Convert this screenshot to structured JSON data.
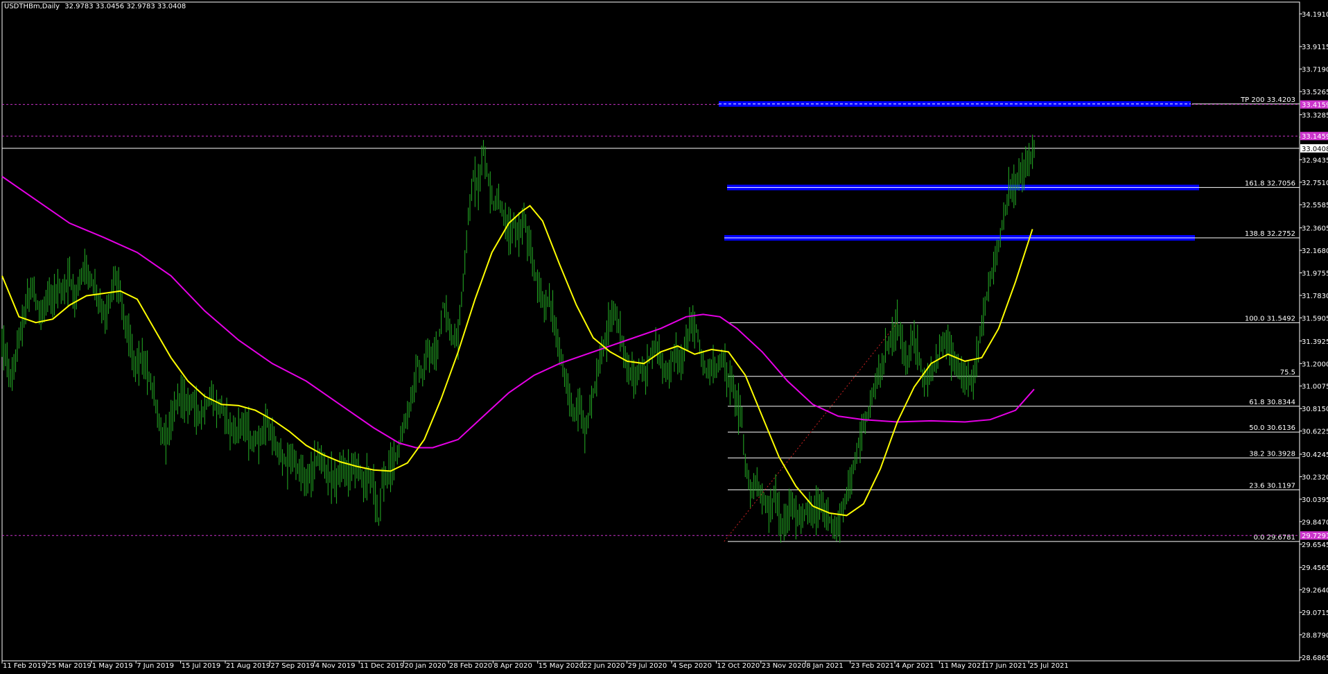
{
  "header": {
    "symbol": "USDTHBm,Daily",
    "ohlc": "32.9783 33.0456 32.9783 33.0408"
  },
  "colors": {
    "background": "#000000",
    "candles": "#22a322",
    "ma_fast": "#ffff00",
    "ma_slow": "#e600e6",
    "fibo_line": "#ffffff",
    "dash_level": "#cc33cc",
    "blue_zone": "#0000ff",
    "trend": "#cc2222"
  },
  "chart_data": {
    "type": "line",
    "title": "",
    "xlabel": "",
    "ylabel": "",
    "ylim": [
      28.6865,
      34.191
    ],
    "y_ticks": [
      "34.1910",
      "33.9115",
      "33.7190",
      "33.5265",
      "33.3285",
      "33.1360",
      "32.9435",
      "32.7510",
      "32.5585",
      "32.3605",
      "32.1680",
      "31.9755",
      "31.7830",
      "31.5905",
      "31.3925",
      "31.2000",
      "31.0075",
      "30.8150",
      "30.6225",
      "30.4245",
      "30.2320",
      "30.0395",
      "29.8470",
      "29.6545",
      "29.4565",
      "29.2640",
      "29.0715",
      "28.8790",
      "28.6865"
    ],
    "x_ticks": [
      "11 Feb 2019",
      "25 Mar 2019",
      "1 May 2019",
      "7 Jun 2019",
      "15 Jul 2019",
      "21 Aug 2019",
      "27 Sep 2019",
      "4 Nov 2019",
      "11 Dec 2019",
      "20 Jan 2020",
      "28 Feb 2020",
      "8 Apr 2020",
      "15 May 2020",
      "22 Jun 2020",
      "29 Jul 2020",
      "4 Sep 2020",
      "12 Oct 2020",
      "23 Nov 2020",
      "8 Jan 2021",
      "23 Feb 2021",
      "4 Apr 2021",
      "11 May 2021",
      "17 Jun 2021",
      "25 Jul 2021"
    ],
    "price_series": [
      [
        0,
        31.4
      ],
      [
        6,
        31.2
      ],
      [
        12,
        31.05
      ],
      [
        18,
        31.35
      ],
      [
        24,
        31.55
      ],
      [
        30,
        31.75
      ],
      [
        36,
        31.85
      ],
      [
        42,
        31.7
      ],
      [
        48,
        31.6
      ],
      [
        54,
        31.8
      ],
      [
        60,
        31.7
      ],
      [
        66,
        31.85
      ],
      [
        72,
        31.8
      ],
      [
        80,
        31.95
      ],
      [
        86,
        31.75
      ],
      [
        92,
        31.9
      ],
      [
        98,
        32.05
      ],
      [
        104,
        31.95
      ],
      [
        110,
        31.85
      ],
      [
        116,
        31.7
      ],
      [
        122,
        31.6
      ],
      [
        128,
        31.75
      ],
      [
        134,
        31.95
      ],
      [
        140,
        31.8
      ],
      [
        146,
        31.55
      ],
      [
        152,
        31.35
      ],
      [
        158,
        31.2
      ],
      [
        164,
        31.25
      ],
      [
        170,
        31.15
      ],
      [
        176,
        31.05
      ],
      [
        182,
        30.85
      ],
      [
        188,
        30.6
      ],
      [
        194,
        30.55
      ],
      [
        200,
        30.7
      ],
      [
        206,
        30.85
      ],
      [
        212,
        30.95
      ],
      [
        218,
        30.85
      ],
      [
        224,
        30.9
      ],
      [
        230,
        30.8
      ],
      [
        236,
        30.75
      ],
      [
        242,
        30.85
      ],
      [
        248,
        30.9
      ],
      [
        254,
        30.8
      ],
      [
        260,
        30.85
      ],
      [
        266,
        30.7
      ],
      [
        272,
        30.65
      ],
      [
        278,
        30.6
      ],
      [
        284,
        30.7
      ],
      [
        290,
        30.65
      ],
      [
        296,
        30.5
      ],
      [
        302,
        30.55
      ],
      [
        308,
        30.6
      ],
      [
        314,
        30.7
      ],
      [
        320,
        30.55
      ],
      [
        326,
        30.45
      ],
      [
        332,
        30.4
      ],
      [
        338,
        30.35
      ],
      [
        344,
        30.4
      ],
      [
        350,
        30.3
      ],
      [
        356,
        30.25
      ],
      [
        362,
        30.2
      ],
      [
        368,
        30.3
      ],
      [
        374,
        30.4
      ],
      [
        380,
        30.35
      ],
      [
        386,
        30.25
      ],
      [
        392,
        30.2
      ],
      [
        398,
        30.25
      ],
      [
        404,
        30.3
      ],
      [
        410,
        30.25
      ],
      [
        416,
        30.35
      ],
      [
        422,
        30.3
      ],
      [
        428,
        30.2
      ],
      [
        434,
        30.25
      ],
      [
        440,
        30.15
      ],
      [
        446,
        29.85
      ],
      [
        450,
        30.2
      ],
      [
        456,
        30.25
      ],
      [
        462,
        30.35
      ],
      [
        468,
        30.45
      ],
      [
        474,
        30.6
      ],
      [
        480,
        30.75
      ],
      [
        486,
        30.95
      ],
      [
        492,
        31.2
      ],
      [
        498,
        31.05
      ],
      [
        504,
        31.3
      ],
      [
        510,
        31.25
      ],
      [
        516,
        31.35
      ],
      [
        522,
        31.7
      ],
      [
        528,
        31.55
      ],
      [
        534,
        31.4
      ],
      [
        540,
        31.45
      ],
      [
        546,
        31.9
      ],
      [
        552,
        32.45
      ],
      [
        558,
        32.8
      ],
      [
        564,
        32.7
      ],
      [
        570,
        33.05
      ],
      [
        576,
        32.75
      ],
      [
        582,
        32.55
      ],
      [
        588,
        32.6
      ],
      [
        594,
        32.45
      ],
      [
        600,
        32.3
      ],
      [
        606,
        32.4
      ],
      [
        612,
        32.3
      ],
      [
        618,
        32.45
      ],
      [
        624,
        32.2
      ],
      [
        630,
        32.0
      ],
      [
        636,
        31.85
      ],
      [
        642,
        31.7
      ],
      [
        648,
        31.75
      ],
      [
        654,
        31.55
      ],
      [
        660,
        31.3
      ],
      [
        666,
        31.1
      ],
      [
        672,
        30.9
      ],
      [
        678,
        30.75
      ],
      [
        684,
        30.85
      ],
      [
        690,
        30.6
      ],
      [
        696,
        30.8
      ],
      [
        702,
        31.0
      ],
      [
        708,
        31.2
      ],
      [
        714,
        31.4
      ],
      [
        720,
        31.55
      ],
      [
        726,
        31.65
      ],
      [
        732,
        31.45
      ],
      [
        738,
        31.25
      ],
      [
        744,
        31.1
      ],
      [
        750,
        31.05
      ],
      [
        756,
        31.15
      ],
      [
        762,
        31.1
      ],
      [
        768,
        31.3
      ],
      [
        774,
        31.35
      ],
      [
        780,
        31.25
      ],
      [
        786,
        31.1
      ],
      [
        792,
        31.2
      ],
      [
        798,
        31.35
      ],
      [
        804,
        31.15
      ],
      [
        810,
        31.4
      ],
      [
        816,
        31.55
      ],
      [
        822,
        31.5
      ],
      [
        828,
        31.25
      ],
      [
        834,
        31.1
      ],
      [
        840,
        31.2
      ],
      [
        846,
        31.15
      ],
      [
        852,
        31.25
      ],
      [
        858,
        31.1
      ],
      [
        864,
        31.05
      ],
      [
        870,
        30.9
      ],
      [
        876,
        30.7
      ],
      [
        880,
        30.35
      ],
      [
        886,
        30.1
      ],
      [
        892,
        30.2
      ],
      [
        898,
        30.05
      ],
      [
        904,
        30.0
      ],
      [
        910,
        29.95
      ],
      [
        916,
        30.1
      ],
      [
        922,
        29.8
      ],
      [
        928,
        29.85
      ],
      [
        934,
        30.0
      ],
      [
        940,
        29.9
      ],
      [
        946,
        29.85
      ],
      [
        952,
        29.95
      ],
      [
        958,
        29.9
      ],
      [
        964,
        29.95
      ],
      [
        970,
        30.0
      ],
      [
        976,
        29.9
      ],
      [
        982,
        29.85
      ],
      [
        988,
        29.75
      ],
      [
        994,
        29.95
      ],
      [
        1000,
        30.05
      ],
      [
        1006,
        30.25
      ],
      [
        1012,
        30.45
      ],
      [
        1018,
        30.65
      ],
      [
        1024,
        30.75
      ],
      [
        1030,
        30.9
      ],
      [
        1036,
        31.05
      ],
      [
        1042,
        31.15
      ],
      [
        1048,
        31.35
      ],
      [
        1054,
        31.45
      ],
      [
        1060,
        31.55
      ],
      [
        1066,
        31.35
      ],
      [
        1072,
        31.2
      ],
      [
        1078,
        31.4
      ],
      [
        1084,
        31.3
      ],
      [
        1090,
        31.1
      ],
      [
        1096,
        31.05
      ],
      [
        1102,
        31.15
      ],
      [
        1108,
        31.25
      ],
      [
        1114,
        31.4
      ],
      [
        1120,
        31.35
      ],
      [
        1126,
        31.25
      ],
      [
        1132,
        31.15
      ],
      [
        1138,
        31.05
      ],
      [
        1144,
        31.05
      ],
      [
        1150,
        31.1
      ],
      [
        1156,
        31.35
      ],
      [
        1162,
        31.6
      ],
      [
        1168,
        31.85
      ],
      [
        1174,
        32.05
      ],
      [
        1180,
        32.2
      ],
      [
        1186,
        32.45
      ],
      [
        1192,
        32.65
      ],
      [
        1198,
        32.7
      ],
      [
        1204,
        32.8
      ],
      [
        1210,
        32.85
      ],
      [
        1216,
        32.95
      ],
      [
        1222,
        33.04
      ]
    ],
    "ma_fast": [
      [
        0,
        31.95
      ],
      [
        20,
        31.6
      ],
      [
        40,
        31.55
      ],
      [
        60,
        31.58
      ],
      [
        80,
        31.7
      ],
      [
        100,
        31.78
      ],
      [
        120,
        31.8
      ],
      [
        140,
        31.82
      ],
      [
        160,
        31.75
      ],
      [
        180,
        31.5
      ],
      [
        200,
        31.25
      ],
      [
        220,
        31.05
      ],
      [
        240,
        30.92
      ],
      [
        260,
        30.85
      ],
      [
        280,
        30.84
      ],
      [
        300,
        30.8
      ],
      [
        320,
        30.72
      ],
      [
        340,
        30.62
      ],
      [
        360,
        30.5
      ],
      [
        380,
        30.42
      ],
      [
        400,
        30.36
      ],
      [
        420,
        30.32
      ],
      [
        440,
        30.29
      ],
      [
        460,
        30.28
      ],
      [
        480,
        30.35
      ],
      [
        500,
        30.55
      ],
      [
        520,
        30.9
      ],
      [
        540,
        31.3
      ],
      [
        560,
        31.75
      ],
      [
        580,
        32.15
      ],
      [
        600,
        32.4
      ],
      [
        615,
        32.5
      ],
      [
        625,
        32.55
      ],
      [
        640,
        32.42
      ],
      [
        660,
        32.05
      ],
      [
        680,
        31.7
      ],
      [
        700,
        31.42
      ],
      [
        720,
        31.3
      ],
      [
        740,
        31.22
      ],
      [
        760,
        31.2
      ],
      [
        780,
        31.3
      ],
      [
        800,
        31.35
      ],
      [
        820,
        31.28
      ],
      [
        840,
        31.32
      ],
      [
        860,
        31.3
      ],
      [
        880,
        31.1
      ],
      [
        900,
        30.75
      ],
      [
        920,
        30.4
      ],
      [
        940,
        30.15
      ],
      [
        960,
        29.98
      ],
      [
        980,
        29.92
      ],
      [
        1000,
        29.9
      ],
      [
        1020,
        30.0
      ],
      [
        1040,
        30.3
      ],
      [
        1060,
        30.7
      ],
      [
        1080,
        31.0
      ],
      [
        1100,
        31.2
      ],
      [
        1120,
        31.28
      ],
      [
        1140,
        31.22
      ],
      [
        1160,
        31.25
      ],
      [
        1180,
        31.5
      ],
      [
        1200,
        31.9
      ],
      [
        1220,
        32.35
      ]
    ],
    "ma_slow": [
      [
        0,
        32.8
      ],
      [
        40,
        32.6
      ],
      [
        80,
        32.4
      ],
      [
        120,
        32.28
      ],
      [
        160,
        32.15
      ],
      [
        200,
        31.95
      ],
      [
        240,
        31.65
      ],
      [
        280,
        31.4
      ],
      [
        320,
        31.2
      ],
      [
        360,
        31.05
      ],
      [
        400,
        30.85
      ],
      [
        440,
        30.65
      ],
      [
        470,
        30.52
      ],
      [
        490,
        30.48
      ],
      [
        510,
        30.48
      ],
      [
        540,
        30.55
      ],
      [
        570,
        30.75
      ],
      [
        600,
        30.95
      ],
      [
        630,
        31.1
      ],
      [
        660,
        31.2
      ],
      [
        700,
        31.3
      ],
      [
        740,
        31.4
      ],
      [
        780,
        31.5
      ],
      [
        810,
        31.6
      ],
      [
        830,
        31.62
      ],
      [
        850,
        31.6
      ],
      [
        870,
        31.5
      ],
      [
        900,
        31.3
      ],
      [
        930,
        31.05
      ],
      [
        960,
        30.85
      ],
      [
        990,
        30.75
      ],
      [
        1020,
        30.72
      ],
      [
        1060,
        30.7
      ],
      [
        1100,
        30.71
      ],
      [
        1140,
        30.7
      ],
      [
        1170,
        30.72
      ],
      [
        1200,
        30.8
      ],
      [
        1222,
        30.98
      ]
    ],
    "fibo_levels": [
      {
        "label": "0.0 29.6781",
        "value": 29.6781
      },
      {
        "label": "23.6 30.1197",
        "value": 30.1197
      },
      {
        "label": "38.2 30.3928",
        "value": 30.3928
      },
      {
        "label": "50.0 30.6136",
        "value": 30.6136
      },
      {
        "label": "61.8 30.8344",
        "value": 30.8344
      },
      {
        "label": "75.5",
        "value": 31.09
      },
      {
        "label": "100.0 31.5492",
        "value": 31.5492
      },
      {
        "label": "138.8 32.2752",
        "value": 32.2752
      },
      {
        "label": "161.8 32.7056",
        "value": 32.7056
      },
      {
        "label": "TP 200 33.4203",
        "value": 33.4203
      }
    ],
    "dash_levels": [
      {
        "label": "33.4159",
        "value": 33.4159
      },
      {
        "label": "33.1459",
        "value": 33.1459
      },
      {
        "label": "29.7291",
        "value": 29.7291
      }
    ],
    "current_price": {
      "label": "33.0408",
      "value": 33.0408
    },
    "blue_zones": [
      33.4203,
      32.7056,
      32.2752
    ]
  }
}
